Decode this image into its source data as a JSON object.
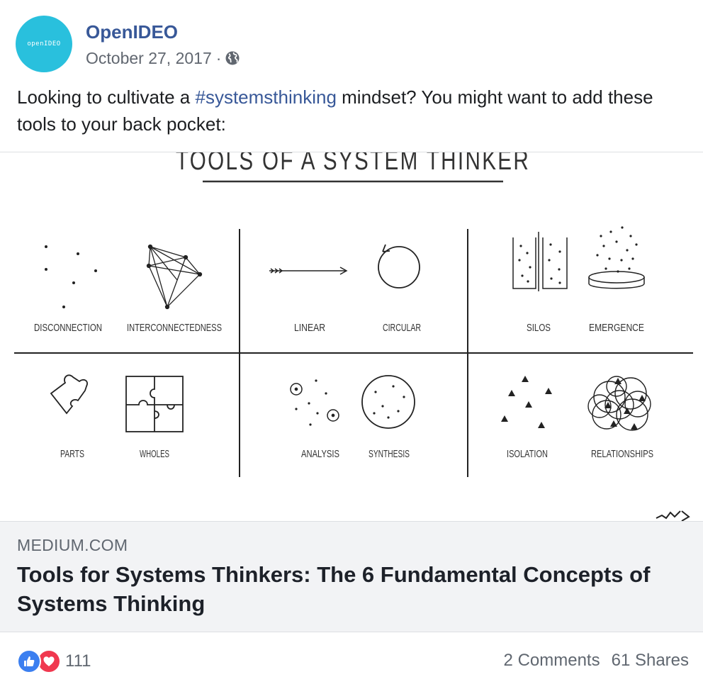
{
  "page": {
    "name": "OpenIDEO",
    "avatar_text": "openIDEO",
    "date": "October 27, 2017",
    "separator": "·",
    "privacy_icon": "globe-icon"
  },
  "post": {
    "text_before": "Looking to cultivate a ",
    "hashtag": "#systemsthinking",
    "text_after": " mindset? You might want to add these tools to your back pocket:"
  },
  "attachment": {
    "image": {
      "heading": "TOOLS OF A SYSTEM THINKER",
      "labels": {
        "disconnection": "DISCONNECTION",
        "interconnectedness": "INTERCONNECTEDNESS",
        "linear": "LINEAR",
        "circular": "CIRCULAR",
        "silos": "SILOS",
        "emergence": "EMERGENCE",
        "parts": "PARTS",
        "wholes": "WHOLES",
        "analysis": "ANALYSIS",
        "synthesis": "SYNTHESIS",
        "isolation": "ISOLATION",
        "relationships": "RELATIONSHIPS"
      }
    },
    "domain": "MEDIUM.COM",
    "title": "Tools for Systems Thinkers: The 6 Fundamental Concepts of Systems Thinking"
  },
  "footer": {
    "reaction_icons": [
      "like-icon",
      "love-icon"
    ],
    "reaction_count": "111",
    "comments": "2 Comments",
    "shares": "61 Shares"
  },
  "colors": {
    "link_blue": "#385898",
    "avatar_bg": "#29c0dd",
    "like_blue": "#3b7ff0",
    "love_red": "#f0384f",
    "meta_gray": "#616770",
    "link_box_bg": "#f2f3f5"
  }
}
